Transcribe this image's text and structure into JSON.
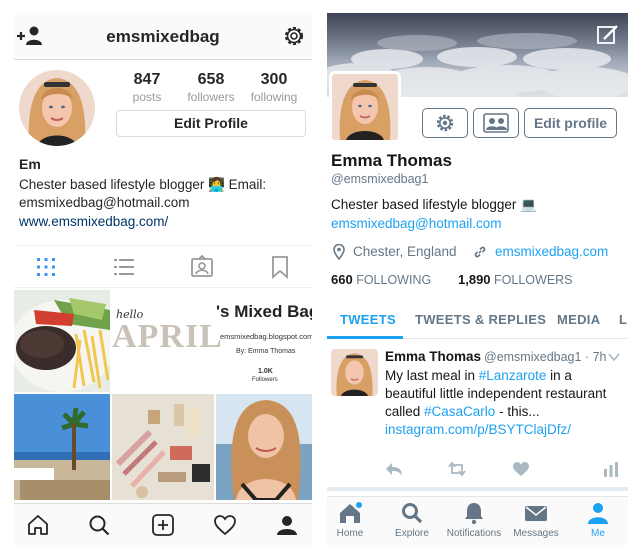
{
  "instagram": {
    "username": "emsmixedbag",
    "stats": [
      {
        "value": "847",
        "label": "posts"
      },
      {
        "value": "658",
        "label": "followers"
      },
      {
        "value": "300",
        "label": "following"
      }
    ],
    "edit_profile_label": "Edit Profile",
    "display_name": "Em",
    "bio_line1": "Chester based lifestyle blogger 👩‍💻 Email:",
    "bio_line2": "emsmixedbag@hotmail.com",
    "website": "www.emsmixedbag.com/",
    "grid": {
      "post2_hello": "hello",
      "post2_month": "APRIL",
      "post2_title": "'s Mixed Bag",
      "post2_url": "emsmixedbag.blogspot.com",
      "post2_by": "By: Emma Thomas",
      "post2_count": "1.0K",
      "post2_count_label": "Followers"
    }
  },
  "twitter": {
    "name": "Emma Thomas",
    "handle": "@emsmixedbag1",
    "edit_profile_label": "Edit profile",
    "bio_text": "Chester based lifestyle blogger 💻",
    "bio_email": "emsmixedbag@hotmail.com",
    "location": "Chester, England",
    "website": "emsmixedbag.com",
    "following_count": "660",
    "following_label": "FOLLOWING",
    "followers_count": "1,890",
    "followers_label": "FOLLOWERS",
    "tabs": [
      "TWEETS",
      "TWEETS & REPLIES",
      "MEDIA",
      "L"
    ],
    "active_tab": "TWEETS",
    "tweet": {
      "name": "Emma Thomas",
      "meta": "@emsmixedbag1 · 7h",
      "text_1": "My last meal in ",
      "hashtag_1": "#Lanzarote",
      "text_2": " in a beautiful little independent restaurant called ",
      "hashtag_2": "#CasaCarlo",
      "text_3": " - this... ",
      "link": "instagram.com/p/BSYTClajDfz/"
    },
    "nav": [
      {
        "label": "Home",
        "icon": "home-icon"
      },
      {
        "label": "Explore",
        "icon": "search-icon"
      },
      {
        "label": "Notifications",
        "icon": "bell-icon"
      },
      {
        "label": "Messages",
        "icon": "mail-icon"
      },
      {
        "label": "Me",
        "icon": "person-icon"
      }
    ],
    "colors": {
      "accent": "#1da1f2",
      "muted": "#657786"
    }
  }
}
